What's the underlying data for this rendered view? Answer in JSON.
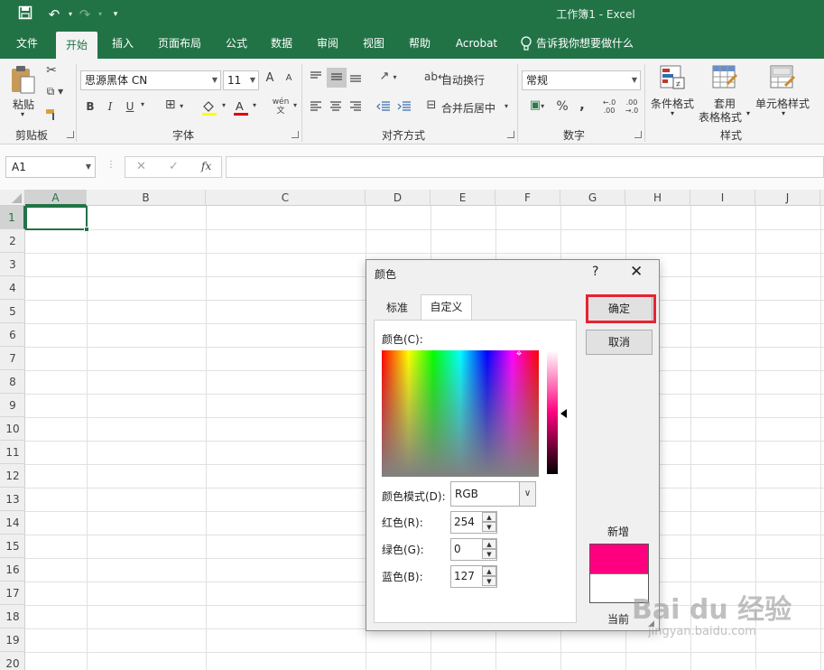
{
  "window": {
    "title": "工作簿1  -  Excel"
  },
  "quick_access": {
    "save_icon": "save-icon",
    "undo_icon": "undo-icon",
    "redo_icon": "redo-icon",
    "customize_icon": "qat-customize-icon"
  },
  "tabs": [
    {
      "label": "文件"
    },
    {
      "label": "开始"
    },
    {
      "label": "插入"
    },
    {
      "label": "页面布局"
    },
    {
      "label": "公式"
    },
    {
      "label": "数据"
    },
    {
      "label": "审阅"
    },
    {
      "label": "视图"
    },
    {
      "label": "帮助"
    },
    {
      "label": "Acrobat"
    },
    {
      "label": "告诉我你想要做什么"
    }
  ],
  "ribbon": {
    "clipboard": {
      "paste": "粘贴",
      "group": "剪贴板"
    },
    "font": {
      "family": "思源黑体 CN",
      "size": "11",
      "bold": "B",
      "italic": "I",
      "underline": "U",
      "grow": "A",
      "shrink": "A",
      "group": "字体"
    },
    "alignment": {
      "wrap": "自动换行",
      "merge": "合并后居中",
      "group": "对齐方式"
    },
    "number": {
      "format": "常规",
      "percent": "%",
      "comma": ",",
      "group": "数字"
    },
    "styles": {
      "conditional": "条件格式",
      "table_line1": "套用",
      "table_line2": "表格格式",
      "cell_styles": "单元格样式",
      "group": "样式"
    }
  },
  "formula_bar": {
    "name_box": "A1",
    "cancel": "✕",
    "enter": "✓",
    "fx": "fx",
    "value": ""
  },
  "sheet": {
    "columns": [
      "A",
      "B",
      "C",
      "D",
      "E",
      "F",
      "G",
      "H",
      "I",
      "J"
    ],
    "rows": [
      "1",
      "2",
      "3",
      "4",
      "5",
      "6",
      "7",
      "8",
      "9",
      "10",
      "11",
      "12",
      "13",
      "14",
      "15",
      "16",
      "17",
      "18",
      "19",
      "20"
    ],
    "active_cell": "A1"
  },
  "dialog": {
    "title": "颜色",
    "help": "?",
    "close": "✕",
    "tabs": {
      "standard": "标准",
      "custom": "自定义"
    },
    "colors_label": "颜色(C):",
    "mode_label": "颜色模式(D):",
    "mode_value": "RGB",
    "red_label": "红色(R):",
    "red_value": "254",
    "green_label": "绿色(G):",
    "green_value": "0",
    "blue_label": "蓝色(B):",
    "blue_value": "127",
    "ok": "确定",
    "cancel": "取消",
    "new_label": "新增",
    "current_label": "当前",
    "new_color": "#fe007f",
    "current_color": "#ffffff"
  },
  "colors": {
    "accent": "#217346",
    "highlight": "#e52332"
  },
  "watermark": {
    "main": "Bai du 经验",
    "sub": "jingyan.baidu.com"
  }
}
